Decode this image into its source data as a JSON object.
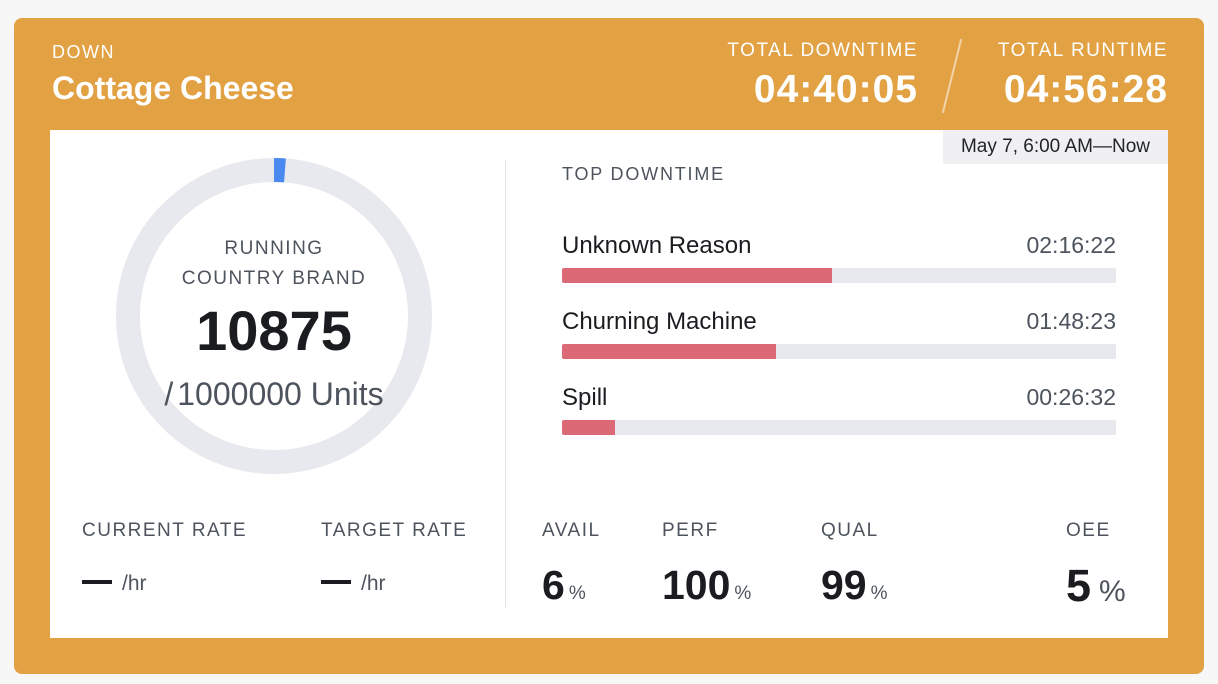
{
  "header": {
    "status": "DOWN",
    "product": "Cottage Cheese",
    "total_downtime_label": "TOTAL DOWNTIME",
    "total_downtime": "04:40:05",
    "total_runtime_label": "TOTAL RUNTIME",
    "total_runtime": "04:56:28",
    "status_color": "#e2a143"
  },
  "range": "May 7, 6:00 AM—Now",
  "progress": {
    "label": "RUNNING COUNTRY BRAND",
    "count": "10875",
    "slash": "/",
    "target": "1000000 Units",
    "fraction": 0.010875,
    "ring_color": "#e8e9ee",
    "progress_color": "#4a8af0"
  },
  "rates": {
    "current_label": "CURRENT RATE",
    "current_unit": "/hr",
    "target_label": "TARGET RATE",
    "target_unit": "/hr"
  },
  "top_downtime": {
    "title": "TOP DOWNTIME",
    "bar_color": "#db6a76",
    "items": [
      {
        "name": "Unknown Reason",
        "time": "02:16:22",
        "fraction": 0.487
      },
      {
        "name": "Churning Machine",
        "time": "01:48:23",
        "fraction": 0.387
      },
      {
        "name": "Spill",
        "time": "00:26:32",
        "fraction": 0.095
      }
    ]
  },
  "metrics": {
    "avail_label": "AVAIL",
    "avail": "6",
    "avail_unit": "%",
    "perf_label": "PERF",
    "perf": "100",
    "perf_unit": "%",
    "qual_label": "QUAL",
    "qual": "99",
    "qual_unit": "%",
    "oee_label": "OEE",
    "oee": "5",
    "oee_unit": "%"
  }
}
